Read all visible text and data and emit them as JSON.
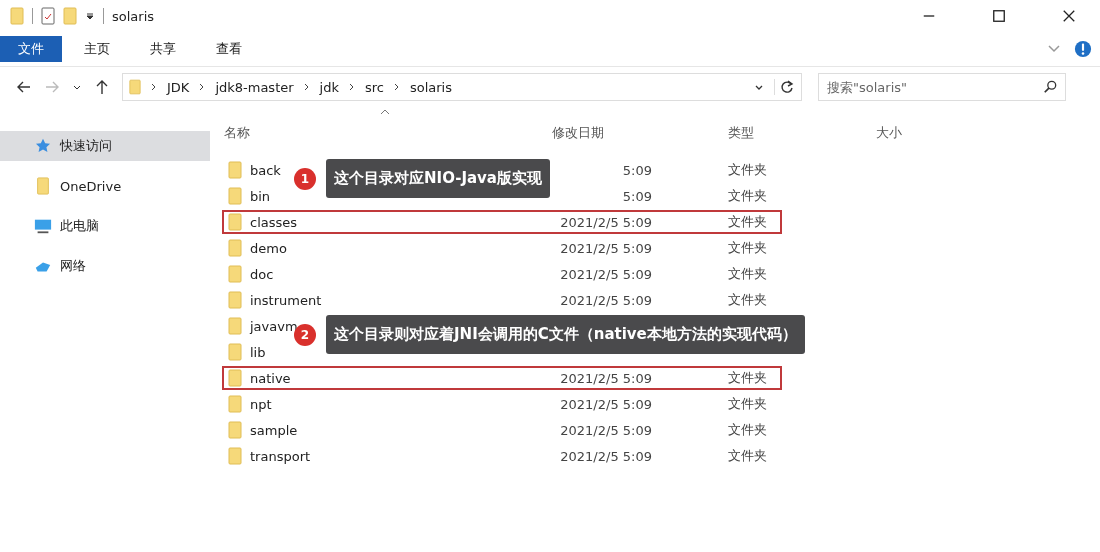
{
  "window": {
    "title": "solaris"
  },
  "ribbon_tabs": [
    {
      "label": "文件",
      "selected": true
    },
    {
      "label": "主页",
      "selected": false
    },
    {
      "label": "共享",
      "selected": false
    },
    {
      "label": "查看",
      "selected": false
    }
  ],
  "address": {
    "crumbs": [
      "JDK",
      "jdk8-master",
      "jdk",
      "src",
      "solaris"
    ]
  },
  "search": {
    "placeholder": "搜索\"solaris\""
  },
  "sidebar": {
    "items": [
      {
        "label": "快速访问",
        "kind": "star",
        "selected": true
      },
      {
        "label": "OneDrive",
        "kind": "folder",
        "selected": false
      },
      {
        "label": "此电脑",
        "kind": "pc",
        "selected": false
      },
      {
        "label": "网络",
        "kind": "network",
        "selected": false
      }
    ]
  },
  "table": {
    "columns": [
      "名称",
      "修改日期",
      "类型",
      "大小"
    ],
    "rows": [
      {
        "name": "back",
        "date": "5:09",
        "type": "文件夹",
        "highlighted": false
      },
      {
        "name": "bin",
        "date": "5:09",
        "type": "文件夹",
        "highlighted": false
      },
      {
        "name": "classes",
        "date": "2021/2/5 5:09",
        "type": "文件夹",
        "highlighted": true
      },
      {
        "name": "demo",
        "date": "2021/2/5 5:09",
        "type": "文件夹",
        "highlighted": false
      },
      {
        "name": "doc",
        "date": "2021/2/5 5:09",
        "type": "文件夹",
        "highlighted": false
      },
      {
        "name": "instrument",
        "date": "2021/2/5 5:09",
        "type": "文件夹",
        "highlighted": false
      },
      {
        "name": "javavm",
        "highlighted": false
      },
      {
        "name": "lib",
        "highlighted": false
      },
      {
        "name": "native",
        "date": "2021/2/5 5:09",
        "type": "文件夹",
        "highlighted": true
      },
      {
        "name": "npt",
        "date": "2021/2/5 5:09",
        "type": "文件夹",
        "highlighted": false
      },
      {
        "name": "sample",
        "date": "2021/2/5 5:09",
        "type": "文件夹",
        "highlighted": false
      },
      {
        "name": "transport",
        "date": "2021/2/5 5:09",
        "type": "文件夹",
        "highlighted": false
      }
    ]
  },
  "callouts": [
    {
      "number": "1",
      "text": "这个目录对应NIO-Java版实现"
    },
    {
      "number": "2",
      "text": "这个目录则对应着JNI会调用的C文件（native本地方法的实现代码）"
    }
  ]
}
